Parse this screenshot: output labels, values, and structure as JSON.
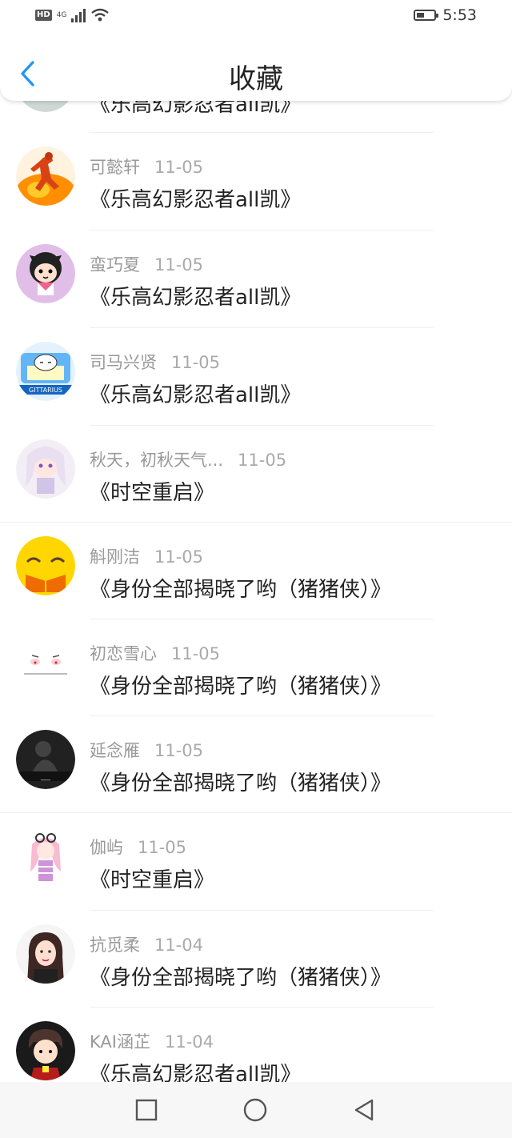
{
  "status": {
    "network": "4G",
    "time": "5:53"
  },
  "header": {
    "title": "收藏"
  },
  "items": [
    {
      "name": "",
      "date": "",
      "work": "《乐高幻影忍者all凯》",
      "avatar": "partial-avatar"
    },
    {
      "name": "可懿轩",
      "date": "11-05",
      "work": "《乐高幻影忍者all凯》",
      "avatar": "runner-avatar"
    },
    {
      "name": "蛮巧夏",
      "date": "11-05",
      "work": "《乐高幻影忍者all凯》",
      "avatar": "cartoon-girl-avatar"
    },
    {
      "name": "司马兴贤",
      "date": "11-05",
      "work": "《乐高幻影忍者all凯》",
      "avatar": "sagittarius-avatar"
    },
    {
      "name": "秋天，初秋天气...",
      "date": "11-05",
      "work": "《时空重启》",
      "avatar": "anime-girl-avatar"
    },
    {
      "name": "斛刚洁",
      "date": "11-05",
      "work": "《身份全部揭晓了哟（猪猪侠）》",
      "avatar": "smiley-avatar"
    },
    {
      "name": "初恋雪心",
      "date": "11-05",
      "work": "《身份全部揭晓了哟（猪猪侠）》",
      "avatar": "blush-face-avatar"
    },
    {
      "name": "延念雁",
      "date": "11-05",
      "work": "《身份全部揭晓了哟（猪猪侠）》",
      "avatar": "dark-avatar"
    },
    {
      "name": "伽屿",
      "date": "11-05",
      "work": "《时空重启》",
      "avatar": "pink-anime-avatar"
    },
    {
      "name": "抗觅柔",
      "date": "11-04",
      "work": "《身份全部揭晓了哟（猪猪侠）》",
      "avatar": "photo-girl-avatar"
    },
    {
      "name": "KAI涵芷",
      "date": "11-04",
      "work": "《乐高幻影忍者all凯》",
      "avatar": "cartoon-boy-avatar"
    }
  ],
  "avatar_svgs": [
    "<circle cx='37' cy='37' r='37' fill='#cfd8d4'/><rect x='10' y='0' width='54' height='25' fill='#a9b8b0'/>",
    "<circle cx='37' cy='37' r='37' fill='#fff3e0'/><ellipse cx='37' cy='56' rx='37' ry='22' fill='#ff8f00'/><ellipse cx='28' cy='54' rx='14' ry='10' fill='#ffca28'/><path d='M34 14 L44 10 L46 18 L40 22 L44 40 L54 50 L48 54 L38 44 L30 56 L24 52 L32 40 L30 26 L22 32 L18 28 L30 18 Z' fill='#d84315'/><circle cx='41' cy='12' r='5' fill='#bf360c'/>",
    "<circle cx='37' cy='37' r='37' fill='#e1bee7'/><circle cx='37' cy='30' r='20' fill='#212121'/><path d='M17 14 L22 24 L27 16 Z M57 14 L52 24 L47 16 Z' fill='#212121'/><ellipse cx='37' cy='36' rx='14' ry='12' fill='#ffe0cc'/><circle cx='31' cy='34' r='2.5' fill='#000'/><circle cx='43' cy='34' r='2.5' fill='#000'/><path d='M34 41 Q37 44 40 41' stroke='#000' fill='none' stroke-width='1.5'/><rect x='27' y='48' width='20' height='16' fill='#ffffff'/><path d='M27 48 L37 58 L47 48' fill='#f06292'/>",
    "<circle cx='37' cy='37' r='37' fill='#e3f2fd'/><rect x='6' y='14' width='62' height='38' rx='6' fill='#64b5f6'/><rect x='14' y='30' width='46' height='18' fill='#fff9c4'/><ellipse cx='37' cy='26' rx='14' ry='10' fill='#ffffff' stroke='#333' stroke-width='1'/><path d='M30 26 L34 26 M40 26 L44 26' stroke='#333' stroke-width='1.5'/><rect x='0' y='54' width='74' height='12' fill='#1565c0'/><text x='37' y='63' font-size='8' fill='#fff' text-anchor='middle' font-family='DejaVu Sans,sans-serif'>GITTARIUS</text>",
    "<circle cx='37' cy='37' r='37' fill='#f3eef5'/><circle cx='37' cy='32' r='16' fill='#ffe7e0'/><path d='M14 20 Q37 -2 60 20 L62 58 Q52 50 50 30 Q37 18 24 30 Q22 50 12 58 Z' fill='#e8dff0'/><circle cx='31' cy='33' r='2.5' fill='#7e57c2'/><circle cx='43' cy='33' r='2.5' fill='#7e57c2'/><rect x='26' y='48' width='22' height='20' fill='#d1c4e9'/>",
    "<circle cx='37' cy='37' r='37' fill='#ffd600'/><path d='M14 32 Q22 24 30 32' stroke='#5d4037' stroke-width='3' fill='none'/><path d='M44 32 Q52 24 60 32' stroke='#5d4037' stroke-width='3' fill='none'/><path d='M12 48 L37 56 L62 48 L62 70 L12 70 Z' fill='#ef6c00'/><path d='M37 56 L37 70' stroke='#ffd600' stroke-width='2'/>",
    "<circle cx='37' cy='37' r='37' fill='#ffffff'/><ellipse cx='24' cy='36' rx='6' ry='4' fill='#ffcdd2'/><ellipse cx='50' cy='36' rx='6' ry='4' fill='#ffcdd2'/><path d='M20 28 L28 30 M46 30 L54 28' stroke='#555' stroke-width='1.5'/><circle cx='24' cy='37' r='1.5' fill='#c62828'/><circle cx='50' cy='37' r='1.5' fill='#c62828'/><rect x='10' y='50' width='54' height='2' fill='#bbb'/>",
    "<circle cx='37' cy='37' r='37' fill='#212121'/><circle cx='34' cy='24' r='10' fill='#424242'/><path d='M22 50 Q34 28 48 44 L54 56 L18 56 Z' fill='#424242'/><rect x='0' y='52' width='74' height='12' fill='#111'/><text x='37' y='61' font-size='8' fill='#eee' text-anchor='middle' font-family='DejaVu Sans,sans-serif'>___</text>",
    "<circle cx='37' cy='37' r='37' fill='#ffffff'/><path d='M20 22 Q37 6 54 22 L56 56 Q46 48 44 30 L30 30 Q28 48 18 56 Z' fill='#f8bbd0'/><circle cx='37' cy='30' r='11' fill='#ffe8e0'/><circle cx='30' cy='14' r='5' fill='none' stroke='#333' stroke-width='2'/><circle cx='44' cy='14' r='5' fill='none' stroke='#333' stroke-width='2'/><rect x='28' y='42' width='18' height='26' fill='#ce93d8'/><path d='M28 50 L46 50 M28 58 L46 58' stroke='#ffffff' stroke-width='2'/>",
    "<circle cx='37' cy='37' r='37' fill='#f5f5f5'/><path d='M16 40 Q14 10 37 10 Q60 10 58 40 L60 74 L14 74 Z' fill='#3e2723'/><ellipse cx='37' cy='36' rx='13' ry='16' fill='#ffe0d0'/><circle cx='32' cy='34' r='1.8' fill='#333'/><circle cx='42' cy='34' r='1.8' fill='#333'/><path d='M33 44 Q37 47 41 44' stroke='#c2185b' stroke-width='1.5' fill='none'/><rect x='22' y='56' width='30' height='18' fill='#212121'/>",
    "<circle cx='37' cy='37' r='37' fill='#1a1a1a'/><path d='M16 34 Q14 10 37 10 Q60 10 58 34 L52 26 L22 26 Z' fill='#4e342e'/><ellipse cx='37' cy='38' rx='15' ry='15' fill='#ffe0cc'/><circle cx='31' cy='38' r='2' fill='#000'/><circle cx='43' cy='38' r='2' fill='#000'/><path d='M22 58 L52 58 L56 74 L18 74 Z' fill='#b71c1c'/><rect x='33' y='56' width='8' height='8' fill='#ffeb3b'/>"
  ]
}
